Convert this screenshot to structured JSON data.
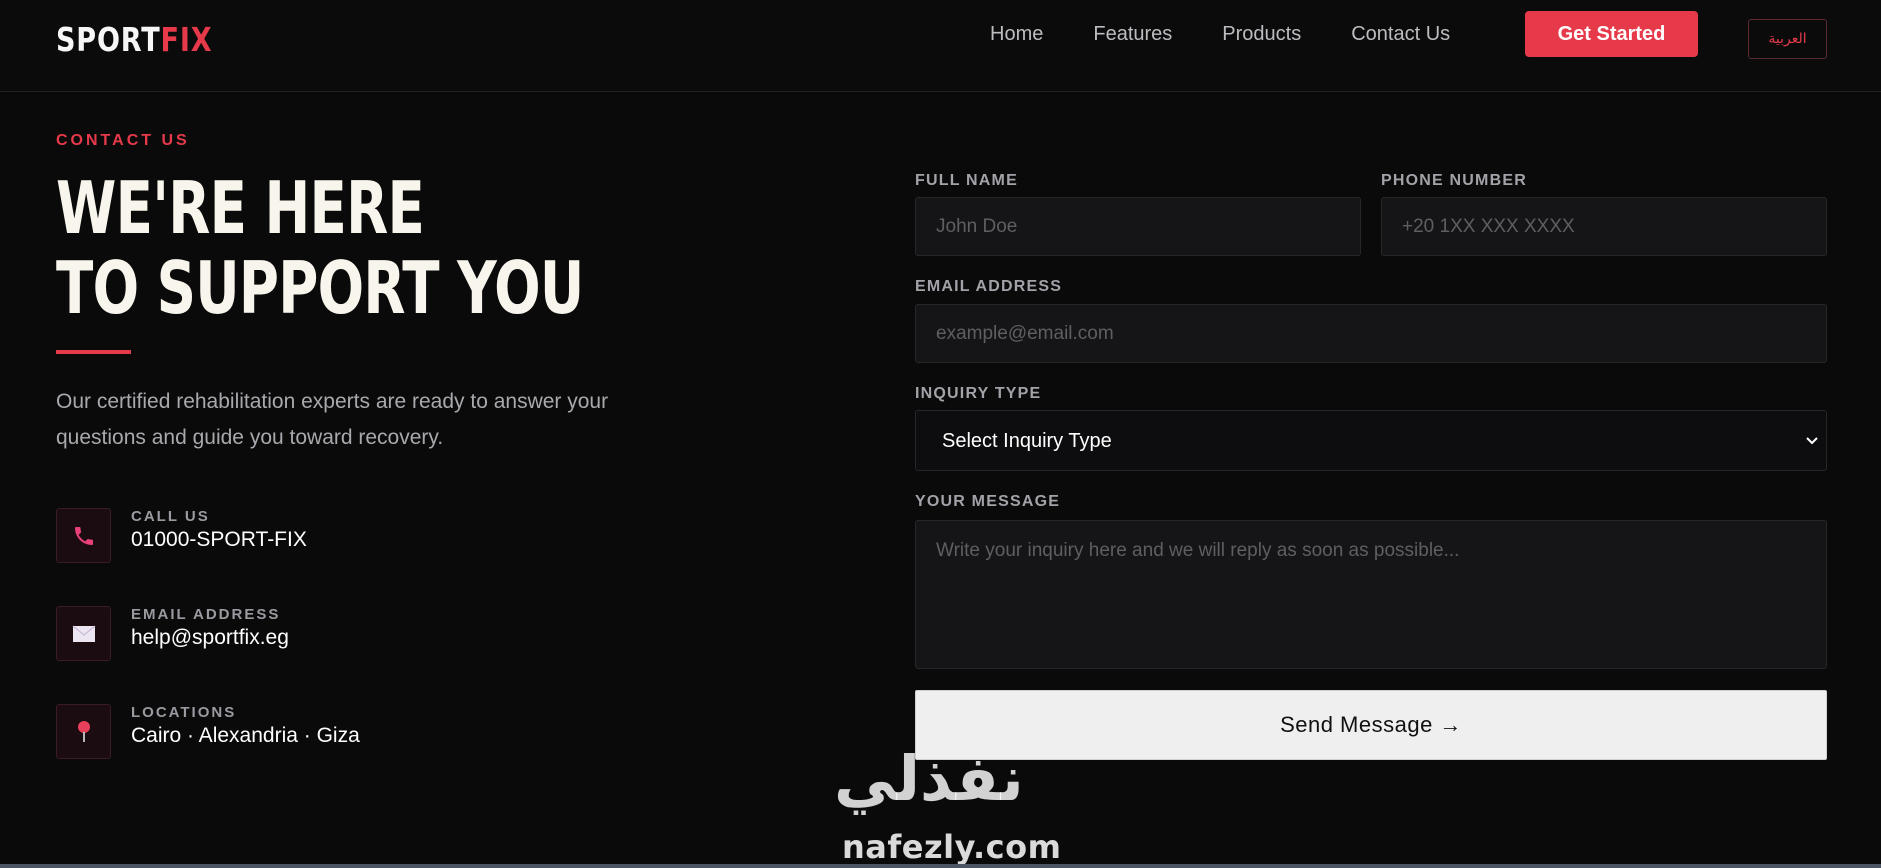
{
  "nav": {
    "logo_main": "SPORT",
    "logo_accent": "FIX",
    "links": [
      "Home",
      "Features",
      "Products",
      "Contact Us"
    ],
    "cta": "Get Started",
    "lang": "العربية"
  },
  "hero": {
    "eyebrow": "CONTACT US",
    "headline_line1": "WE'RE HERE",
    "headline_line2": "TO SUPPORT YOU",
    "intro": "Our certified rehabilitation experts are ready to answer your questions and guide you toward recovery."
  },
  "contacts": [
    {
      "label": "CALL US",
      "value": "01000-SPORT-FIX",
      "icon": "phone-icon"
    },
    {
      "label": "EMAIL ADDRESS",
      "value": "help@sportfix.eg",
      "icon": "envelope-icon"
    },
    {
      "label": "LOCATIONS",
      "value": "Cairo · Alexandria · Giza",
      "icon": "pin-icon"
    }
  ],
  "form": {
    "full_name_label": "FULL NAME",
    "full_name_placeholder": "John Doe",
    "phone_label": "PHONE NUMBER",
    "phone_placeholder": "+20 1XX XXX XXXX",
    "email_label": "EMAIL ADDRESS",
    "email_placeholder": "example@email.com",
    "inquiry_label": "INQUIRY TYPE",
    "inquiry_selected": "Select Inquiry Type",
    "message_label": "YOUR MESSAGE",
    "message_placeholder": "Write your inquiry here and we will reply as soon as possible...",
    "submit": "Send Message →"
  },
  "watermark": {
    "arabic": "نفذلي",
    "latin": "nafezly.com"
  },
  "colors": {
    "accent": "#e63a4a",
    "background": "#0a0a0b"
  }
}
